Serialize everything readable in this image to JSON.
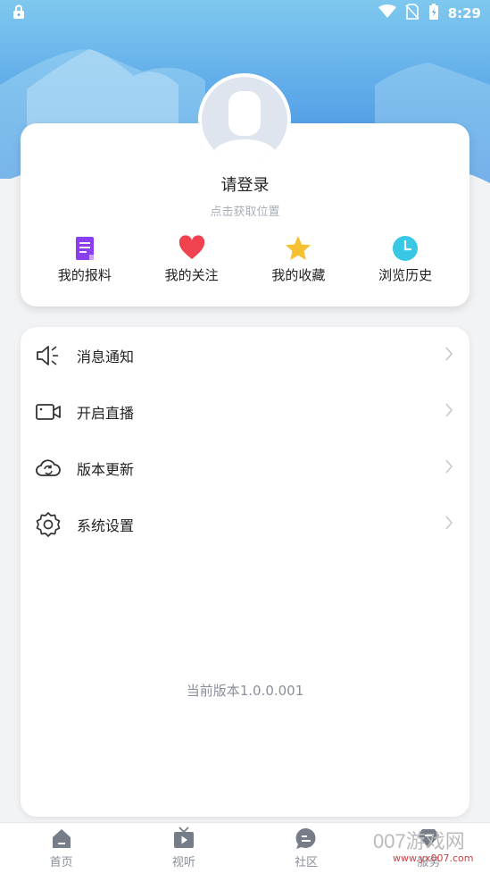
{
  "status_bar": {
    "time": "8:29"
  },
  "profile": {
    "login_prompt": "请登录",
    "location_hint": "点击获取位置",
    "quick_links": [
      {
        "label": "我的报料",
        "icon": "document-icon",
        "color": "#8b3df2"
      },
      {
        "label": "我的关注",
        "icon": "heart-icon",
        "color": "#f0424f"
      },
      {
        "label": "我的收藏",
        "icon": "star-icon",
        "color": "#f5c130"
      },
      {
        "label": "浏览历史",
        "icon": "clock-icon",
        "color": "#37c8e6"
      }
    ]
  },
  "menu": {
    "items": [
      {
        "label": "消息通知",
        "icon": "speaker-icon"
      },
      {
        "label": "开启直播",
        "icon": "video-camera-icon"
      },
      {
        "label": "版本更新",
        "icon": "cloud-refresh-icon"
      },
      {
        "label": "系统设置",
        "icon": "gear-icon"
      }
    ],
    "version_text": "当前版本1.0.0.001"
  },
  "tabbar": {
    "tabs": [
      {
        "label": "首页",
        "icon": "home-icon"
      },
      {
        "label": "视听",
        "icon": "tv-icon"
      },
      {
        "label": "社区",
        "icon": "chat-icon"
      },
      {
        "label": "服务",
        "icon": "diamond-icon"
      }
    ]
  },
  "watermark": {
    "text": "007游戏网",
    "url": "www.yx007.com"
  },
  "colors": {
    "header_top": "#7ec8ef",
    "header_bottom": "#4a8fe0",
    "background": "#f2f3f5"
  }
}
